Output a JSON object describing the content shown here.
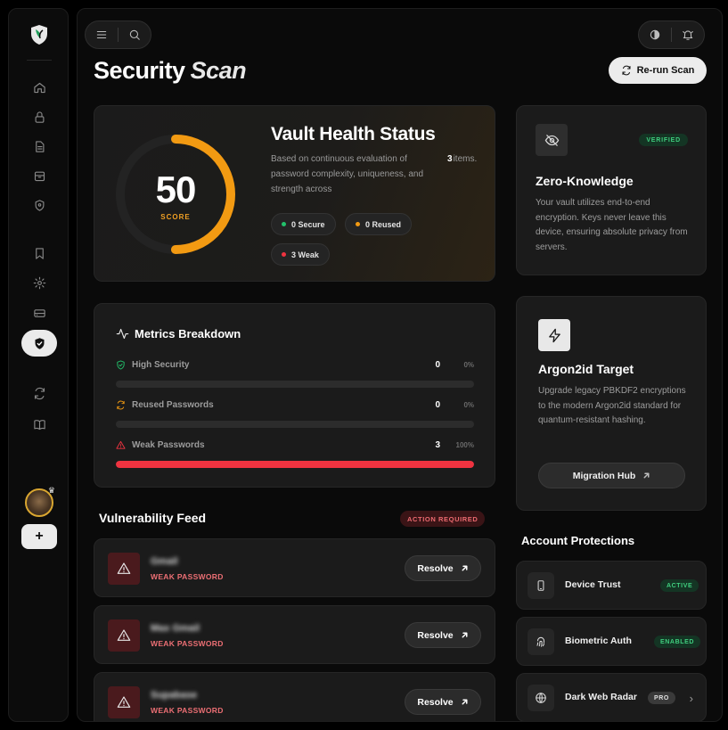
{
  "page": {
    "title": "Security",
    "title_accent": "Scan",
    "rerun_label": "Re-run Scan"
  },
  "health": {
    "score": "50",
    "score_label": "SCORE",
    "score_fraction": 0.5,
    "title": "Vault Health Status",
    "description": "Based on continuous evaluation of password complexity, uniqueness, and strength across",
    "item_count": "3",
    "item_suffix": "items.",
    "chips": {
      "secure": "0 Secure",
      "reused": "0 Reused",
      "weak": "3 Weak"
    }
  },
  "metrics": {
    "title": "Metrics Breakdown",
    "rows": [
      {
        "label": "High Security",
        "count": "0",
        "percent": "0%",
        "fraction": 0
      },
      {
        "label": "Reused Passwords",
        "count": "0",
        "percent": "0%",
        "fraction": 0
      },
      {
        "label": "Weak Passwords",
        "count": "3",
        "percent": "100%",
        "fraction": 1
      }
    ]
  },
  "feed": {
    "title": "Vulnerability Feed",
    "badge": "ACTION REQUIRED",
    "items": [
      {
        "name": "Gmail",
        "type": "WEAK PASSWORD",
        "action": "Resolve"
      },
      {
        "name": "Max Gmail",
        "type": "WEAK PASSWORD",
        "action": "Resolve"
      },
      {
        "name": "Supabase",
        "type": "WEAK PASSWORD",
        "action": "Resolve"
      }
    ]
  },
  "zero_knowledge": {
    "badge": "VERIFIED",
    "title": "Zero-Knowledge",
    "description": "Your vault utilizes end-to-end encryption. Keys never leave this device, ensuring absolute privacy from servers."
  },
  "argon": {
    "title": "Argon2id Target",
    "description": "Upgrade legacy PBKDF2 encryptions to the modern Argon2id standard for quantum-resistant hashing.",
    "button": "Migration Hub"
  },
  "protections": {
    "title": "Account Protections",
    "items": [
      {
        "name": "Device Trust",
        "badge": "ACTIVE"
      },
      {
        "name": "Biometric Auth",
        "badge": "ENABLED"
      },
      {
        "name": "Dark Web Radar",
        "badge": "PRO"
      }
    ]
  },
  "colors": {
    "accent_orange": "#f29a12",
    "danger_red": "#ef3340",
    "success_green": "#3fce7e"
  },
  "icons": {
    "sidebar": [
      "home-icon",
      "lock-icon",
      "document-icon",
      "archive-icon",
      "location-shield-icon",
      "bookmark-icon",
      "settings-icon",
      "storage-icon",
      "shield-check-icon",
      "sync-icon",
      "book-icon"
    ]
  }
}
